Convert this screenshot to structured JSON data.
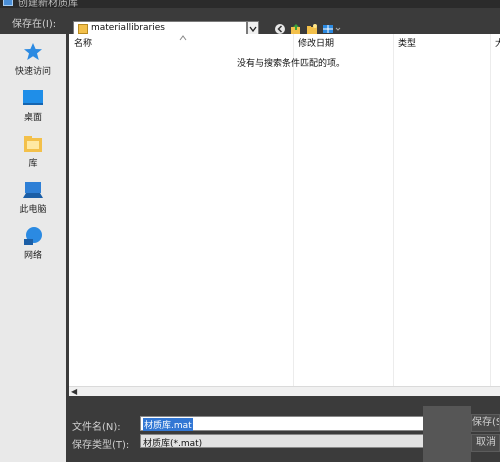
{
  "window": {
    "title": "创建新材质库"
  },
  "toolbar": {
    "save_in_label": "保存在(I):",
    "location": "materiallibraries",
    "icons": [
      "back-icon",
      "up-folder-icon",
      "new-folder-icon",
      "view-menu-icon"
    ]
  },
  "places": [
    {
      "label": "快速访问",
      "icon": "star-icon"
    },
    {
      "label": "桌面",
      "icon": "desktop-icon"
    },
    {
      "label": "库",
      "icon": "library-icon"
    },
    {
      "label": "此电脑",
      "icon": "computer-icon"
    },
    {
      "label": "网络",
      "icon": "network-icon"
    }
  ],
  "filelist": {
    "columns": [
      "名称",
      "修改日期",
      "类型",
      "大"
    ],
    "empty_message": "没有与搜索条件匹配的项。"
  },
  "bottom": {
    "filename_label": "文件名(N):",
    "filename_value": "材质库.mat",
    "filetype_label": "保存类型(T):",
    "filetype_value": "材质库(*.mat)",
    "save_button": "保存(S)",
    "cancel_button": "取消"
  },
  "colors": {
    "background": "#3b3b3b",
    "places_bg": "#e9e9e9",
    "selection": "#3277d4",
    "folder": "#f3c04a",
    "accent_blue": "#2b8ae2"
  }
}
